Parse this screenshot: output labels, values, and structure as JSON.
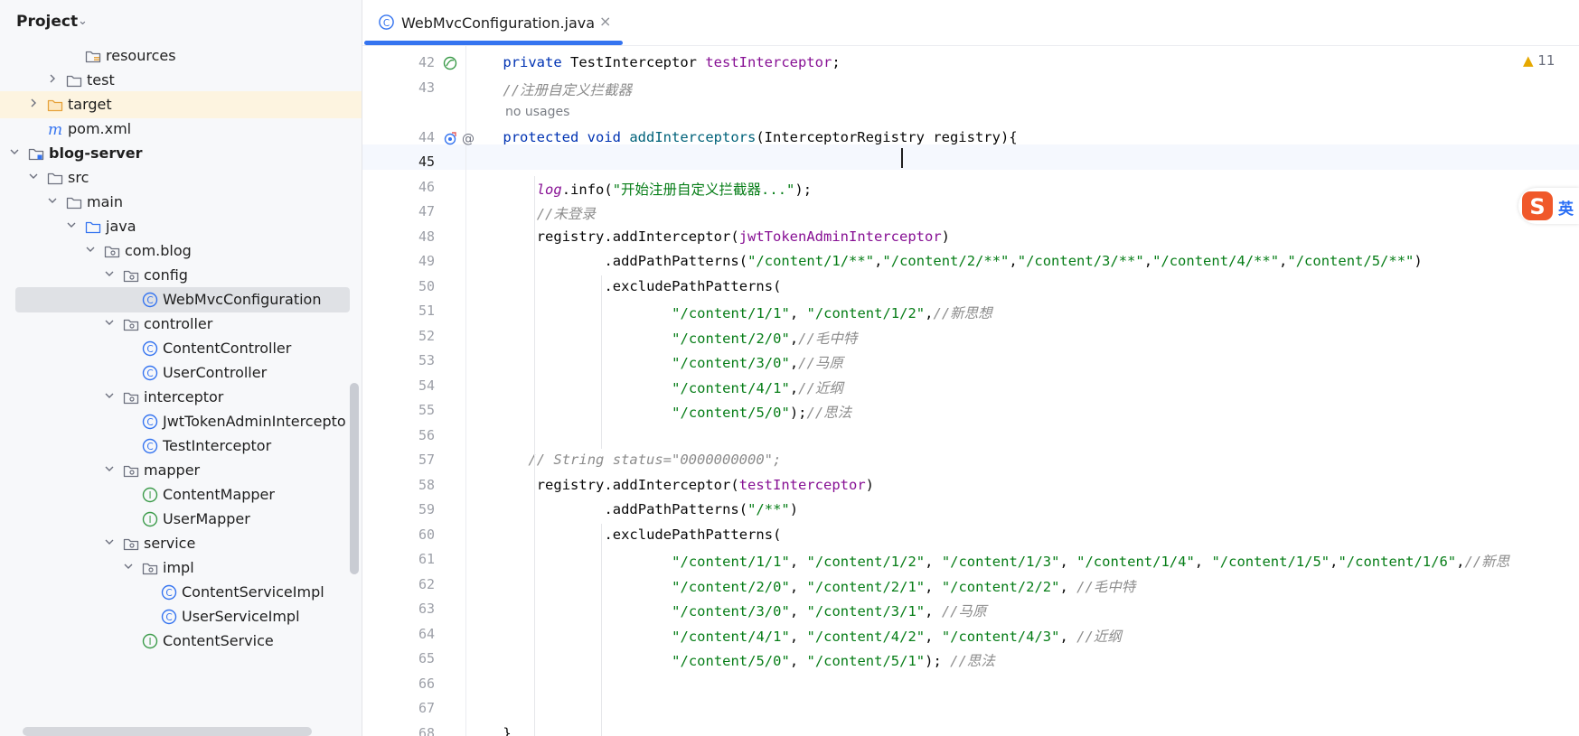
{
  "project_panel": {
    "title": "Project",
    "tree": [
      {
        "label": "resources",
        "kind": "resources-folder",
        "depth": 4,
        "arrow": "none"
      },
      {
        "label": "test",
        "kind": "folder",
        "depth": 3,
        "arrow": "collapsed"
      },
      {
        "label": "target",
        "kind": "target-folder",
        "depth": 2,
        "arrow": "collapsed",
        "highlight": true
      },
      {
        "label": "pom.xml",
        "kind": "maven",
        "depth": 2,
        "arrow": "none"
      },
      {
        "label": "blog-server",
        "kind": "module",
        "depth": 1,
        "arrow": "expanded",
        "bold": true
      },
      {
        "label": "src",
        "kind": "folder",
        "depth": 2,
        "arrow": "expanded"
      },
      {
        "label": "main",
        "kind": "folder",
        "depth": 3,
        "arrow": "expanded"
      },
      {
        "label": "java",
        "kind": "source-folder",
        "depth": 4,
        "arrow": "expanded"
      },
      {
        "label": "com.blog",
        "kind": "package",
        "depth": 5,
        "arrow": "expanded"
      },
      {
        "label": "config",
        "kind": "package",
        "depth": 6,
        "arrow": "expanded"
      },
      {
        "label": "WebMvcConfiguration",
        "kind": "class",
        "depth": 7,
        "arrow": "none",
        "selected": true
      },
      {
        "label": "controller",
        "kind": "package",
        "depth": 6,
        "arrow": "expanded"
      },
      {
        "label": "ContentController",
        "kind": "class",
        "depth": 7,
        "arrow": "none"
      },
      {
        "label": "UserController",
        "kind": "class",
        "depth": 7,
        "arrow": "none"
      },
      {
        "label": "interceptor",
        "kind": "package",
        "depth": 6,
        "arrow": "expanded"
      },
      {
        "label": "JwtTokenAdminIntercepto",
        "kind": "class",
        "depth": 7,
        "arrow": "none"
      },
      {
        "label": "TestInterceptor",
        "kind": "class",
        "depth": 7,
        "arrow": "none"
      },
      {
        "label": "mapper",
        "kind": "package",
        "depth": 6,
        "arrow": "expanded"
      },
      {
        "label": "ContentMapper",
        "kind": "interface",
        "depth": 7,
        "arrow": "none"
      },
      {
        "label": "UserMapper",
        "kind": "interface",
        "depth": 7,
        "arrow": "none"
      },
      {
        "label": "service",
        "kind": "package",
        "depth": 6,
        "arrow": "expanded"
      },
      {
        "label": "impl",
        "kind": "package",
        "depth": 7,
        "arrow": "expanded"
      },
      {
        "label": "ContentServiceImpl",
        "kind": "class",
        "depth": 8,
        "arrow": "none"
      },
      {
        "label": "UserServiceImpl",
        "kind": "class",
        "depth": 8,
        "arrow": "none"
      },
      {
        "label": "ContentService",
        "kind": "interface",
        "depth": 7,
        "arrow": "none"
      }
    ]
  },
  "editor_tab": {
    "label": "WebMvcConfiguration.java",
    "close": "×"
  },
  "editor": {
    "warnings": "11",
    "current_line": 45,
    "lines": [
      {
        "n": "42",
        "indent": 4,
        "gutter": "bean",
        "tokens": [
          [
            "kw",
            "private "
          ],
          [
            "",
            "TestInterceptor "
          ],
          [
            "fld",
            "testInterceptor"
          ],
          [
            "",
            ";"
          ]
        ]
      },
      {
        "n": "43",
        "indent": 4,
        "tokens": [
          [
            "cmt",
            "//注册自定义拦截器"
          ]
        ]
      },
      {
        "inlay": "no usages",
        "indent": 4
      },
      {
        "n": "44",
        "indent": 4,
        "gutter": "override",
        "tokens": [
          [
            "kw",
            "protected void "
          ],
          [
            "mth",
            "addInterceptors"
          ],
          [
            "",
            "(InterceptorRegistry registry){"
          ]
        ]
      },
      {
        "n": "45",
        "indent": 8,
        "tokens": []
      },
      {
        "n": "46",
        "indent": 8,
        "tokens": [
          [
            "fldi",
            "log"
          ],
          [
            "",
            ".info("
          ],
          [
            "str",
            "\"开始注册自定义拦截器...\""
          ],
          [
            "",
            ");"
          ]
        ]
      },
      {
        "n": "47",
        "indent": 8,
        "tokens": [
          [
            "cmt",
            "//未登录"
          ]
        ]
      },
      {
        "n": "48",
        "indent": 8,
        "tokens": [
          [
            "",
            "registry.addInterceptor("
          ],
          [
            "fld",
            "jwtTokenAdminInterceptor"
          ],
          [
            "",
            ")"
          ]
        ]
      },
      {
        "n": "49",
        "indent": 16,
        "tokens": [
          [
            "",
            ".addPathPatterns("
          ],
          [
            "str",
            "\"/content/1/**\""
          ],
          [
            "",
            ","
          ],
          [
            "str",
            "\"/content/2/**\""
          ],
          [
            "",
            ","
          ],
          [
            "str",
            "\"/content/3/**\""
          ],
          [
            "",
            ","
          ],
          [
            "str",
            "\"/content/4/**\""
          ],
          [
            "",
            ","
          ],
          [
            "str",
            "\"/content/5/**\""
          ],
          [
            "",
            ")"
          ]
        ]
      },
      {
        "n": "50",
        "indent": 16,
        "tokens": [
          [
            "",
            ".excludePathPatterns("
          ]
        ]
      },
      {
        "n": "51",
        "indent": 24,
        "tokens": [
          [
            "str",
            "\"/content/1/1\""
          ],
          [
            "",
            ", "
          ],
          [
            "str",
            "\"/content/1/2\""
          ],
          [
            "",
            ","
          ],
          [
            "cmt",
            "//新思想"
          ]
        ]
      },
      {
        "n": "52",
        "indent": 24,
        "tokens": [
          [
            "str",
            "\"/content/2/0\""
          ],
          [
            "",
            ","
          ],
          [
            "cmt",
            "//毛中特"
          ]
        ]
      },
      {
        "n": "53",
        "indent": 24,
        "tokens": [
          [
            "str",
            "\"/content/3/0\""
          ],
          [
            "",
            ","
          ],
          [
            "cmt",
            "//马原"
          ]
        ]
      },
      {
        "n": "54",
        "indent": 24,
        "tokens": [
          [
            "str",
            "\"/content/4/1\""
          ],
          [
            "",
            ","
          ],
          [
            "cmt",
            "//近纲"
          ]
        ]
      },
      {
        "n": "55",
        "indent": 24,
        "tokens": [
          [
            "str",
            "\"/content/5/0\""
          ],
          [
            "",
            ");"
          ],
          [
            "cmt",
            "//思法"
          ]
        ]
      },
      {
        "n": "56",
        "indent": 0,
        "tokens": []
      },
      {
        "n": "57",
        "indent": 7,
        "tokens": [
          [
            "cmt",
            "// String status=\"0000000000\";"
          ]
        ]
      },
      {
        "n": "58",
        "indent": 8,
        "tokens": [
          [
            "",
            "registry.addInterceptor("
          ],
          [
            "fld",
            "testInterceptor"
          ],
          [
            "",
            ")"
          ]
        ]
      },
      {
        "n": "59",
        "indent": 16,
        "tokens": [
          [
            "",
            ".addPathPatterns("
          ],
          [
            "str",
            "\"/**\""
          ],
          [
            "",
            ")"
          ]
        ]
      },
      {
        "n": "60",
        "indent": 16,
        "tokens": [
          [
            "",
            ".excludePathPatterns("
          ]
        ]
      },
      {
        "n": "61",
        "indent": 24,
        "tokens": [
          [
            "str",
            "\"/content/1/1\""
          ],
          [
            "",
            ", "
          ],
          [
            "str",
            "\"/content/1/2\""
          ],
          [
            "",
            ", "
          ],
          [
            "str",
            "\"/content/1/3\""
          ],
          [
            "",
            ", "
          ],
          [
            "str",
            "\"/content/1/4\""
          ],
          [
            "",
            ", "
          ],
          [
            "str",
            "\"/content/1/5\""
          ],
          [
            "",
            ","
          ],
          [
            "str",
            "\"/content/1/6\""
          ],
          [
            "",
            ","
          ],
          [
            "cmt",
            "//新思"
          ]
        ]
      },
      {
        "n": "62",
        "indent": 24,
        "tokens": [
          [
            "str",
            "\"/content/2/0\""
          ],
          [
            "",
            ", "
          ],
          [
            "str",
            "\"/content/2/1\""
          ],
          [
            "",
            ", "
          ],
          [
            "str",
            "\"/content/2/2\""
          ],
          [
            "",
            ", "
          ],
          [
            "cmt",
            "//毛中特"
          ]
        ]
      },
      {
        "n": "63",
        "indent": 24,
        "tokens": [
          [
            "str",
            "\"/content/3/0\""
          ],
          [
            "",
            ", "
          ],
          [
            "str",
            "\"/content/3/1\""
          ],
          [
            "",
            ", "
          ],
          [
            "cmt",
            "//马原"
          ]
        ]
      },
      {
        "n": "64",
        "indent": 24,
        "tokens": [
          [
            "str",
            "\"/content/4/1\""
          ],
          [
            "",
            ", "
          ],
          [
            "str",
            "\"/content/4/2\""
          ],
          [
            "",
            ", "
          ],
          [
            "str",
            "\"/content/4/3\""
          ],
          [
            "",
            ", "
          ],
          [
            "cmt",
            "//近纲"
          ]
        ]
      },
      {
        "n": "65",
        "indent": 24,
        "tokens": [
          [
            "str",
            "\"/content/5/0\""
          ],
          [
            "",
            ", "
          ],
          [
            "str",
            "\"/content/5/1\""
          ],
          [
            "",
            "); "
          ],
          [
            "cmt",
            "//思法"
          ]
        ]
      },
      {
        "n": "66",
        "indent": 0,
        "tokens": []
      },
      {
        "n": "67",
        "indent": 0,
        "tokens": []
      },
      {
        "n": "68",
        "indent": 4,
        "tokens": [
          [
            "",
            "}"
          ]
        ]
      }
    ]
  },
  "ime": {
    "label": "英"
  },
  "colors": {
    "accent": "#3574f0",
    "keyword": "#0033b3",
    "string": "#067d17",
    "field": "#871094",
    "comment": "#8c8c8c",
    "method": "#00627a"
  }
}
